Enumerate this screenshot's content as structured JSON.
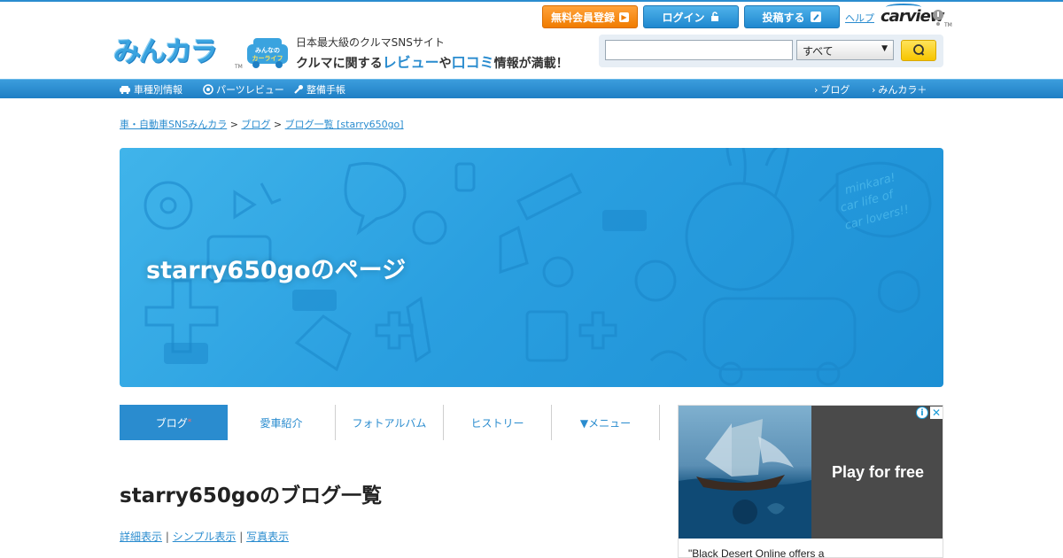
{
  "header": {
    "logo_text": "みんカラ",
    "logo_tm": "TM",
    "mascot_badge_line1": "みんなの",
    "mascot_badge_line2": "カーライフ",
    "tagline_1": "日本最大級のクルマSNSサイト",
    "tagline_2_a": "クルマに関する",
    "tagline_2_b": "レビュー",
    "tagline_2_c": "や",
    "tagline_2_d": "口コミ",
    "tagline_2_e": "情報が満載！",
    "buttons": {
      "register": "無料会員登録",
      "login": "ログイン",
      "post": "投稿する"
    },
    "help": "ヘルプ",
    "carview": "carview",
    "carview_tm": "TM"
  },
  "search": {
    "input_value": "",
    "select_value": "すべて"
  },
  "nav": {
    "left": [
      "車種別情報",
      "パーツレビュー",
      "整備手帳"
    ],
    "right": [
      "ブログ",
      "みんカラ＋"
    ]
  },
  "breadcrumb": {
    "items": [
      "車・自動車SNSみんカラ",
      "ブログ",
      "ブログ一覧 [starry650go]"
    ],
    "separator": ">"
  },
  "banner": {
    "title": "starry650goのページ",
    "doodle_text_1": "minkara!",
    "doodle_text_2": "car life of",
    "doodle_text_3": "car lovers!!"
  },
  "tabs": [
    {
      "label": "ブログ",
      "star": "*"
    },
    {
      "label": "愛車紹介"
    },
    {
      "label": "フォトアルバム"
    },
    {
      "label": "ヒストリー"
    },
    {
      "label": "▼メニュー"
    }
  ],
  "blog": {
    "heading": "starry650goのブログ一覧",
    "view_links": [
      "詳細表示",
      "シンプル表示",
      "写真表示"
    ],
    "view_sep": "|"
  },
  "ad": {
    "cta": "Play for free",
    "caption": "\"Black Desert Online offers a",
    "info_icon": "i",
    "close_icon": "✕"
  },
  "colors": {
    "brand_blue": "#2a8ccf",
    "register_orange": "#f07c00",
    "search_yellow": "#f7c500",
    "banner_blue": "#2a9fe0"
  },
  "icons": [
    "car-icon",
    "gear-icon",
    "wrench-icon",
    "lock-icon",
    "pen-icon",
    "search-icon",
    "chevron-right-icon",
    "info-icon",
    "close-icon"
  ]
}
